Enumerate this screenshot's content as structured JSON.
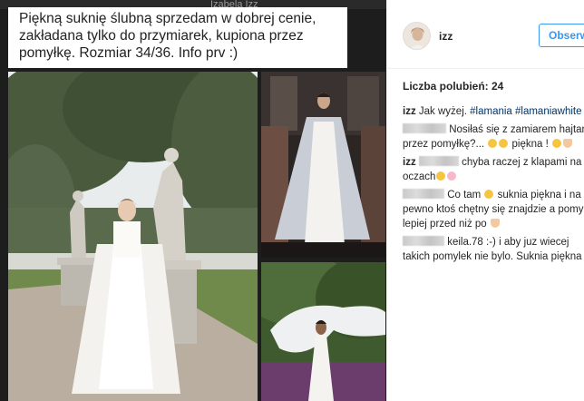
{
  "post": {
    "ghost_name": "Izabela Izz",
    "caption_line1": "Piękną suknię ślubną sprzedam w dobrej cenie,",
    "caption_line2": "zakładana tylko do przymiarek, kupiona przez",
    "caption_line3": "pomyłkę. Rozmiar 34/36. Info prv :)"
  },
  "header": {
    "username": "izz",
    "follow_label": "Obserwuj",
    "follow_color": "#3897f0"
  },
  "likes": {
    "label": "Liczba polubień: 24"
  },
  "comments": [
    {
      "author": "izz",
      "text": " Jak wyżej. ",
      "tags": "#lamania #lamaniawhite"
    },
    {
      "text_a": " Nosiłaś się z zamiarem hajtania",
      "text_b": "przez pomyłkę?... ",
      "text_c": " piękna ! "
    },
    {
      "author": "izz",
      "text_a": " chyba raczej z klapami na",
      "text_b": "oczach"
    },
    {
      "text_a": " Co tam ",
      "text_b": " suknia piękna i na",
      "text_c": "pewno ktoś chętny się znajdzie a pomy",
      "text_d": "lepiej przed niż po "
    },
    {
      "text_a": " keila.78 :-) i aby juz wiecej",
      "text_b": "takich pomylek nie bylo. Suknia piękna"
    }
  ],
  "icons": {
    "emoji": "emoji-icon",
    "hand": "hand-emoji-icon"
  }
}
